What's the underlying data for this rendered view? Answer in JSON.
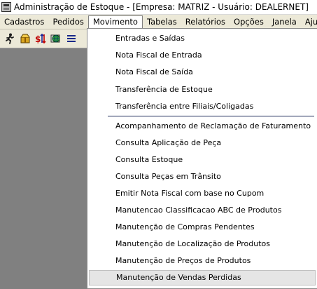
{
  "window": {
    "title": "Administração de Estoque - [Empresa: MATRIZ - Usuário: DEALERNET]"
  },
  "menubar": {
    "items": [
      "Cadastros",
      "Pedidos",
      "Movimento",
      "Tabelas",
      "Relatórios",
      "Opções",
      "Janela",
      "Ajuda"
    ],
    "active": "Movimento"
  },
  "toolbar": {
    "icons": [
      "runner-icon",
      "package-icon",
      "currency-arrows-icon",
      "globe-icon",
      "list-icon"
    ]
  },
  "movimento_menu": {
    "group1": [
      "Entradas e Saídas",
      "Nota Fiscal de Entrada",
      "Nota Fiscal de Saída",
      "Transferência de Estoque",
      "Transferência entre Filiais/Coligadas"
    ],
    "group2": [
      "Acompanhamento de Reclamação de Faturamento",
      "Consulta Aplicação de Peça",
      "Consulta Estoque",
      "Consulta Peças em Trânsito",
      "Emitir Nota Fiscal com base no Cupom",
      "Manutencao Classificacao ABC de Produtos",
      "Manutenção de Compras Pendentes",
      "Manutenção de Localização de Produtos",
      "Manutenção de Preços de Produtos",
      "Manutenção de Vendas Perdidas"
    ],
    "highlighted": "Manutenção de Vendas Perdidas"
  },
  "colors": {
    "menubar_bg": "#ece9d8",
    "workspace_bg": "#808080",
    "separator": "#1e2a5a",
    "hover_bg": "#e5e5e5"
  }
}
